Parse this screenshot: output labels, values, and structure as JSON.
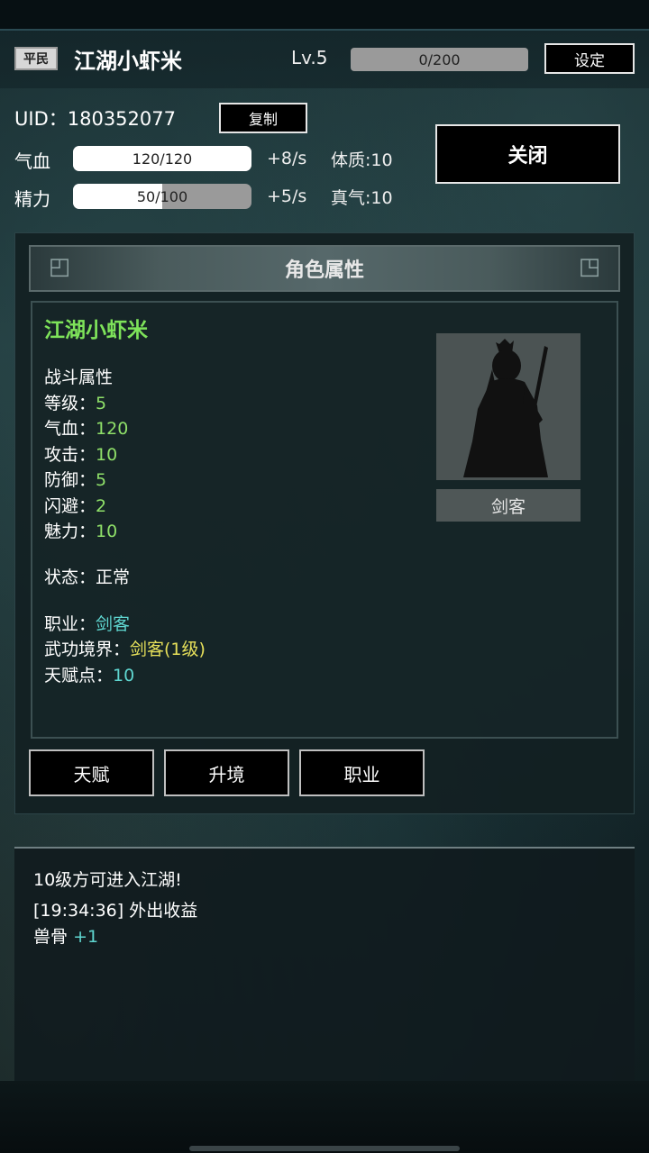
{
  "header": {
    "rank": "平民",
    "player_name": "江湖小虾米",
    "level": "Lv.5",
    "exp": "0/200",
    "settings_label": "设定"
  },
  "profile": {
    "uid_text": "UID：180352077",
    "copy_label": "复制",
    "close_label": "关闭",
    "hp_label": "气血",
    "hp_value": "120/120",
    "hp_fraction": 1.0,
    "hp_rate": "+8/s",
    "constitution": "体质:10",
    "sp_label": "精力",
    "sp_value": "50/100",
    "sp_fraction": 0.5,
    "sp_rate": "+5/s",
    "true_qi": "真气:10"
  },
  "panel": {
    "title": "角色属性",
    "char_name": "江湖小虾米",
    "combat_header": "战斗属性",
    "attrs": [
      {
        "label": "等级：",
        "value": "5"
      },
      {
        "label": "气血：",
        "value": "120"
      },
      {
        "label": "攻击：",
        "value": "10"
      },
      {
        "label": "防御：",
        "value": "5"
      },
      {
        "label": "闪避：",
        "value": "2"
      },
      {
        "label": "魅力：",
        "value": "10"
      }
    ],
    "status_label": "状态：",
    "status_value": "正常",
    "job_label": "职业：",
    "job_value": "剑客",
    "realm_label": "武功境界：",
    "realm_value": "剑客(1级)",
    "talent_label": "天赋点：",
    "talent_value": "10",
    "portrait_caption": "剑客"
  },
  "tabs": [
    "天赋",
    "升境",
    "职业"
  ],
  "log": {
    "lines": [
      "10级方可进入江湖!",
      "[19:34:36] 外出收益"
    ],
    "item_label": "兽骨",
    "item_value": "+1"
  },
  "colors": {
    "green_value": "#8fe069",
    "cyan_value": "#5fd6d0",
    "yellow_value": "#e6e05a",
    "name_green": "#7ee35a"
  }
}
